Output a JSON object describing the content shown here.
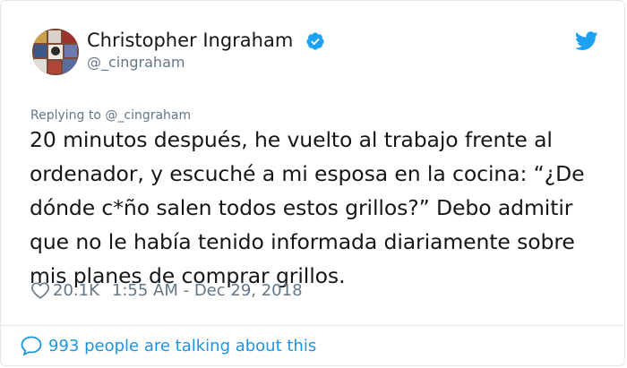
{
  "user": {
    "name": "Christopher Ingraham",
    "handle": "@_cingraham",
    "verified_icon": "verified-badge-icon",
    "avatar_icon": "profile-avatar"
  },
  "brand": {
    "logo_icon": "twitter-bird-icon",
    "accent_color": "#1da1f2",
    "link_color": "#1b95e0"
  },
  "tweet": {
    "replying_to": "Replying to @_cingraham",
    "text": "20 minutos después, he vuelto al trabajo frente al ordenador, y escuché a mi esposa en la cocina: “¿De dónde c*ño salen todos estos grillos?” Debo admitir que no le había tenido informada diariamente sobre mis planes de comprar grillos.",
    "likes": "20.1K",
    "timestamp": "1:55 AM - Dec 29, 2018",
    "like_icon": "heart-outline-icon"
  },
  "footer": {
    "talking_text": "993 people are talking about this",
    "talking_icon": "speech-bubble-icon"
  }
}
